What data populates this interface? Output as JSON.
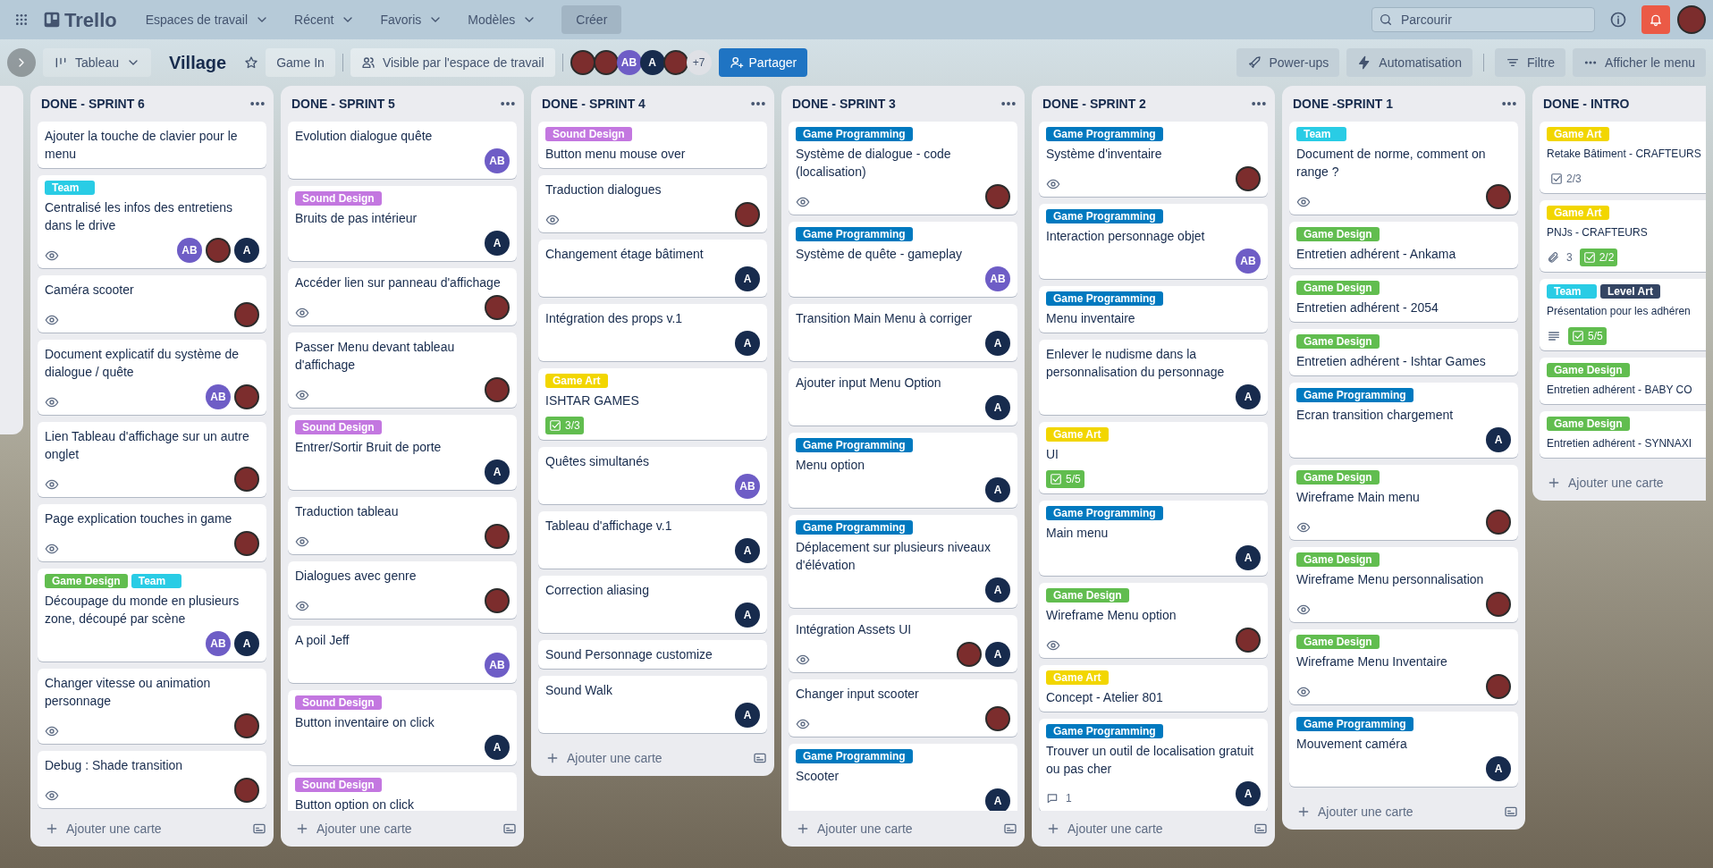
{
  "topbar": {
    "app_name": "Trello",
    "menus": [
      {
        "label": "Espaces de travail"
      },
      {
        "label": "Récent"
      },
      {
        "label": "Favoris"
      },
      {
        "label": "Modèles"
      }
    ],
    "create_button": "Créer",
    "search": {
      "placeholder": "Parcourir"
    }
  },
  "board_header": {
    "view": "Tableau",
    "title": "Village",
    "starred": false,
    "workspace": "Game In",
    "visibility": "Visible par l'espace de travail",
    "members": [
      {
        "kind": "photo"
      },
      {
        "kind": "photo"
      },
      {
        "kind": "initials",
        "text": "AB",
        "color": "#6e5dc6"
      },
      {
        "kind": "initials",
        "text": "A",
        "color": "#172b4d"
      },
      {
        "kind": "photo"
      }
    ],
    "more_members": "+7",
    "share": "Partager",
    "actions": [
      {
        "kind": "rocket",
        "label": "Power-ups"
      },
      {
        "kind": "bolt",
        "label": "Automatisation"
      },
      {
        "kind": "filter",
        "label": "Filtre"
      },
      {
        "kind": "dots",
        "label": "Afficher le menu"
      }
    ]
  },
  "lists": [
    {
      "title": "DONE - SPRINT 6",
      "add_card": "Ajouter une carte",
      "cards": [
        {
          "title": "Ajouter la touche de clavier pour le menu"
        },
        {
          "labels": [
            {
              "text": "Team",
              "color": "#29cce5"
            }
          ],
          "title": "Centralisé les infos des entretiens dans le drive",
          "watching": true,
          "members": [
            {
              "kind": "initials",
              "text": "AB",
              "color": "#6e5dc6"
            },
            {
              "kind": "photo"
            },
            {
              "kind": "initials",
              "text": "A",
              "color": "#172b4d"
            }
          ]
        },
        {
          "title": "Caméra scooter",
          "watching": true,
          "members": [
            {
              "kind": "photo"
            }
          ]
        },
        {
          "title": "Document explicatif du système de dialogue / quête",
          "watching": true,
          "members": [
            {
              "kind": "initials",
              "text": "AB",
              "color": "#6e5dc6"
            },
            {
              "kind": "photo"
            }
          ]
        },
        {
          "title": "Lien Tableau d'affichage sur un autre onglet",
          "watching": true,
          "members": [
            {
              "kind": "photo"
            }
          ]
        },
        {
          "title": "Page explication touches in game",
          "watching": true,
          "members": [
            {
              "kind": "photo"
            }
          ]
        },
        {
          "labels": [
            {
              "text": "Game Design",
              "color": "#61bd4f"
            },
            {
              "text": "Team",
              "color": "#29cce5"
            }
          ],
          "title": "Découpage du monde en plusieurs zone, découpé par scène",
          "members": [
            {
              "kind": "initials",
              "text": "AB",
              "color": "#6e5dc6"
            },
            {
              "kind": "initials",
              "text": "A",
              "color": "#172b4d"
            }
          ]
        },
        {
          "title": "Changer vitesse ou animation personnage",
          "watching": true,
          "members": [
            {
              "kind": "photo"
            }
          ]
        },
        {
          "title": "Debug : Shade transition",
          "watching": true,
          "members": [
            {
              "kind": "photo"
            }
          ]
        }
      ]
    },
    {
      "title": "DONE - SPRINT 5",
      "add_card": "Ajouter une carte",
      "cards": [
        {
          "title": "Evolution dialogue quête",
          "members": [
            {
              "kind": "initials",
              "text": "AB",
              "color": "#6e5dc6"
            }
          ]
        },
        {
          "labels": [
            {
              "text": "Sound Design",
              "color": "#c377e0"
            }
          ],
          "title": "Bruits de pas intérieur",
          "members": [
            {
              "kind": "initials",
              "text": "A",
              "color": "#172b4d"
            }
          ]
        },
        {
          "title": "Accéder lien sur panneau d'affichage",
          "watching": true,
          "members": [
            {
              "kind": "photo"
            }
          ]
        },
        {
          "title": "Passer Menu devant tableau d'affichage",
          "watching": true,
          "members": [
            {
              "kind": "photo"
            }
          ]
        },
        {
          "labels": [
            {
              "text": "Sound Design",
              "color": "#c377e0"
            }
          ],
          "title": "Entrer/Sortir Bruit de porte",
          "members": [
            {
              "kind": "initials",
              "text": "A",
              "color": "#172b4d"
            }
          ]
        },
        {
          "title": "Traduction tableau",
          "watching": true,
          "members": [
            {
              "kind": "photo"
            }
          ]
        },
        {
          "title": "Dialogues avec genre",
          "watching": true,
          "members": [
            {
              "kind": "photo"
            }
          ]
        },
        {
          "title": "A poil Jeff",
          "members": [
            {
              "kind": "initials",
              "text": "AB",
              "color": "#6e5dc6"
            }
          ]
        },
        {
          "labels": [
            {
              "text": "Sound Design",
              "color": "#c377e0"
            }
          ],
          "title": "Button inventaire on click",
          "members": [
            {
              "kind": "initials",
              "text": "A",
              "color": "#172b4d"
            }
          ]
        },
        {
          "labels": [
            {
              "text": "Sound Design",
              "color": "#c377e0"
            }
          ],
          "title": "Button option on click"
        }
      ]
    },
    {
      "title": "DONE - SPRINT 4",
      "add_card": "Ajouter une carte",
      "cards": [
        {
          "labels": [
            {
              "text": "Sound Design",
              "color": "#c377e0"
            }
          ],
          "title": "Button menu mouse over"
        },
        {
          "title": "Traduction dialogues",
          "watching": true,
          "members": [
            {
              "kind": "photo"
            }
          ]
        },
        {
          "title": "Changement étage bâtiment",
          "members": [
            {
              "kind": "initials",
              "text": "A",
              "color": "#172b4d"
            }
          ]
        },
        {
          "title": "Intégration des props v.1",
          "members": [
            {
              "kind": "initials",
              "text": "A",
              "color": "#172b4d"
            }
          ]
        },
        {
          "labels": [
            {
              "text": "Game Art",
              "color": "#f2d600"
            }
          ],
          "title": "ISHTAR GAMES",
          "checklist": {
            "text": "3/3",
            "complete": true
          }
        },
        {
          "title": "Quêtes simultanés",
          "members": [
            {
              "kind": "initials",
              "text": "AB",
              "color": "#6e5dc6"
            }
          ]
        },
        {
          "title": "Tableau d'affichage v.1",
          "members": [
            {
              "kind": "initials",
              "text": "A",
              "color": "#172b4d"
            }
          ]
        },
        {
          "title": "Correction aliasing",
          "members": [
            {
              "kind": "initials",
              "text": "A",
              "color": "#172b4d"
            }
          ]
        },
        {
          "title": "Sound Personnage customize"
        },
        {
          "title": "Sound Walk",
          "members": [
            {
              "kind": "initials",
              "text": "A",
              "color": "#172b4d"
            }
          ]
        }
      ]
    },
    {
      "title": "DONE - SPRINT 3",
      "add_card": "Ajouter une carte",
      "cards": [
        {
          "labels": [
            {
              "text": "Game Programming",
              "color": "#0079bf"
            }
          ],
          "title": "Système de dialogue - code (localisation)",
          "watching": true,
          "members": [
            {
              "kind": "photo"
            }
          ]
        },
        {
          "labels": [
            {
              "text": "Game Programming",
              "color": "#0079bf"
            }
          ],
          "title": "Système de quête - gameplay",
          "members": [
            {
              "kind": "initials",
              "text": "AB",
              "color": "#6e5dc6"
            }
          ]
        },
        {
          "title": "Transition Main Menu à corriger",
          "members": [
            {
              "kind": "initials",
              "text": "A",
              "color": "#172b4d"
            }
          ]
        },
        {
          "title": "Ajouter input Menu Option",
          "members": [
            {
              "kind": "initials",
              "text": "A",
              "color": "#172b4d"
            }
          ]
        },
        {
          "labels": [
            {
              "text": "Game Programming",
              "color": "#0079bf"
            }
          ],
          "title": "Menu option",
          "members": [
            {
              "kind": "initials",
              "text": "A",
              "color": "#172b4d"
            }
          ]
        },
        {
          "labels": [
            {
              "text": "Game Programming",
              "color": "#0079bf"
            }
          ],
          "title": "Déplacement sur plusieurs niveaux d'élévation",
          "members": [
            {
              "kind": "initials",
              "text": "A",
              "color": "#172b4d"
            }
          ]
        },
        {
          "title": "Intégration Assets UI",
          "watching": true,
          "members": [
            {
              "kind": "photo"
            },
            {
              "kind": "initials",
              "text": "A",
              "color": "#172b4d"
            }
          ]
        },
        {
          "title": "Changer input scooter",
          "watching": true,
          "members": [
            {
              "kind": "photo"
            }
          ]
        },
        {
          "labels": [
            {
              "text": "Game Programming",
              "color": "#0079bf"
            }
          ],
          "title": "Scooter",
          "members": [
            {
              "kind": "initials",
              "text": "A",
              "color": "#172b4d"
            }
          ]
        }
      ]
    },
    {
      "title": "DONE - SPRINT 2",
      "add_card": "Ajouter une carte",
      "cards": [
        {
          "labels": [
            {
              "text": "Game Programming",
              "color": "#0079bf"
            }
          ],
          "title": "Système d'inventaire",
          "watching": true,
          "members": [
            {
              "kind": "photo"
            }
          ]
        },
        {
          "labels": [
            {
              "text": "Game Programming",
              "color": "#0079bf"
            }
          ],
          "title": "Interaction personnage objet",
          "members": [
            {
              "kind": "initials",
              "text": "AB",
              "color": "#6e5dc6"
            }
          ]
        },
        {
          "labels": [
            {
              "text": "Game Programming",
              "color": "#0079bf"
            }
          ],
          "title": "Menu inventaire"
        },
        {
          "title": "Enlever le nudisme dans la personnalisation du personnage",
          "members": [
            {
              "kind": "initials",
              "text": "A",
              "color": "#172b4d"
            }
          ]
        },
        {
          "labels": [
            {
              "text": "Game Art",
              "color": "#f2d600"
            }
          ],
          "title": "UI",
          "checklist": {
            "text": "5/5",
            "complete": true
          }
        },
        {
          "labels": [
            {
              "text": "Game Programming",
              "color": "#0079bf"
            }
          ],
          "title": "Main menu",
          "members": [
            {
              "kind": "initials",
              "text": "A",
              "color": "#172b4d"
            }
          ]
        },
        {
          "labels": [
            {
              "text": "Game Design",
              "color": "#61bd4f"
            }
          ],
          "title": "Wireframe Menu option",
          "watching": true,
          "members": [
            {
              "kind": "photo"
            }
          ]
        },
        {
          "labels": [
            {
              "text": "Game Art",
              "color": "#f2d600"
            }
          ],
          "title": "Concept - Atelier 801"
        },
        {
          "labels": [
            {
              "text": "Game Programming",
              "color": "#0079bf"
            }
          ],
          "title": "Trouver un outil de localisation gratuit ou pas cher",
          "comments": "1",
          "members": [
            {
              "kind": "initials",
              "text": "A",
              "color": "#172b4d"
            }
          ]
        }
      ]
    },
    {
      "title": "DONE -SPRINT 1",
      "add_card": "Ajouter une carte",
      "cards": [
        {
          "labels": [
            {
              "text": "Team",
              "color": "#29cce5"
            }
          ],
          "title": "Document de norme, comment on range ?",
          "watching": true,
          "members": [
            {
              "kind": "photo"
            }
          ]
        },
        {
          "labels": [
            {
              "text": "Game Design",
              "color": "#61bd4f"
            }
          ],
          "title": "Entretien adhérent - Ankama"
        },
        {
          "labels": [
            {
              "text": "Game Design",
              "color": "#61bd4f"
            }
          ],
          "title": "Entretien adhérent - 2054"
        },
        {
          "labels": [
            {
              "text": "Game Design",
              "color": "#61bd4f"
            }
          ],
          "title": "Entretien adhérent - Ishtar Games"
        },
        {
          "labels": [
            {
              "text": "Game Programming",
              "color": "#0079bf"
            }
          ],
          "title": "Ecran transition chargement",
          "members": [
            {
              "kind": "initials",
              "text": "A",
              "color": "#172b4d"
            }
          ]
        },
        {
          "labels": [
            {
              "text": "Game Design",
              "color": "#61bd4f"
            }
          ],
          "title": "Wireframe Main menu",
          "watching": true,
          "members": [
            {
              "kind": "photo"
            }
          ]
        },
        {
          "labels": [
            {
              "text": "Game Design",
              "color": "#61bd4f"
            }
          ],
          "title": "Wireframe Menu personnalisation",
          "watching": true,
          "members": [
            {
              "kind": "photo"
            }
          ]
        },
        {
          "labels": [
            {
              "text": "Game Design",
              "color": "#61bd4f"
            }
          ],
          "title": "Wireframe Menu Inventaire",
          "watching": true,
          "members": [
            {
              "kind": "photo"
            }
          ]
        },
        {
          "labels": [
            {
              "text": "Game Programming",
              "color": "#0079bf"
            }
          ],
          "title": "Mouvement caméra",
          "members": [
            {
              "kind": "initials",
              "text": "A",
              "color": "#172b4d"
            }
          ]
        }
      ]
    },
    {
      "title": "DONE - INTRO",
      "add_card": "Ajouter une carte",
      "cards": [
        {
          "labels": [
            {
              "text": "Game Art",
              "color": "#f2d600"
            }
          ],
          "title": "Retake Bâtiment - CRAFTEURS",
          "checklist": {
            "text": "2/3",
            "complete": false
          }
        },
        {
          "labels": [
            {
              "text": "Game Art",
              "color": "#f2d600"
            }
          ],
          "title": "PNJs - CRAFTEURS",
          "attachments": "3",
          "checklist": {
            "text": "2/2",
            "complete": true
          }
        },
        {
          "labels": [
            {
              "text": "Team",
              "color": "#29cce5"
            },
            {
              "text": "Level Art",
              "color": "#344563"
            }
          ],
          "title": "Présentation pour les adhéren",
          "description": true,
          "checklist": {
            "text": "5/5",
            "complete": true
          }
        },
        {
          "labels": [
            {
              "text": "Game Design",
              "color": "#61bd4f"
            }
          ],
          "title": "Entretien adhérent - BABY CO"
        },
        {
          "labels": [
            {
              "text": "Game Design",
              "color": "#61bd4f"
            }
          ],
          "title": "Entretien adhérent - SYNNAXI"
        }
      ]
    }
  ]
}
